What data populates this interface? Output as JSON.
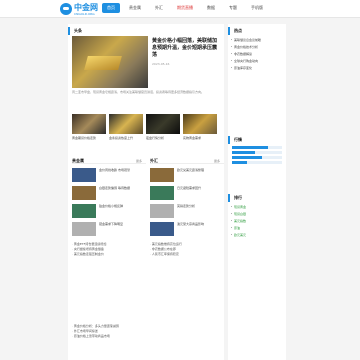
{
  "header": {
    "logo_text": "中金网",
    "logo_sub": "CNGOLD.ORG",
    "nav": [
      {
        "label": "首页",
        "active": true,
        "red": false
      },
      {
        "label": "贵金属",
        "active": false,
        "red": false
      },
      {
        "label": "外汇",
        "active": false,
        "red": false
      },
      {
        "label": "期货直播",
        "active": false,
        "red": true
      },
      {
        "label": "数据",
        "active": false,
        "red": false
      },
      {
        "label": "专题",
        "active": false,
        "red": false
      },
      {
        "label": "手机版",
        "active": false,
        "red": false
      }
    ]
  },
  "main": {
    "section_title": "头条",
    "hero_title": "黄金价格小幅回落，美联储加息预期升温，金价短期承压震荡",
    "hero_meta": "2023-05-16",
    "hero_summary": "周二亚市早盘，现货黄金窄幅震荡，市场关注美联储官员讲话，投资者等待更多经济数据指引方向。",
    "gallery": [
      {
        "caption": "黄金期货价格走势"
      },
      {
        "caption": "金条投资热度上升"
      },
      {
        "caption": "夜盘行情分析"
      },
      {
        "caption": "实物黄金需求"
      }
    ],
    "cols": [
      {
        "title": "贵金属",
        "more": "更多",
        "rows": [
          "金价周线收跌 市场观望",
          "白银走势偏弱 等待数据",
          "铂金价格小幅反弹",
          "钯金需求下降明显"
        ],
        "lines": [
          "· 黄金ETF持仓量连续增加",
          "· 央行继续增持黄金储备",
          "· 美元指数走强压制金价"
        ]
      },
      {
        "title": "外汇",
        "more": "更多",
        "rows": [
          "欧元兑美元震荡整理",
          "日元避险需求回升",
          "英镑走势分析",
          "澳元受大宗商品影响"
        ],
        "lines": [
          "· 美元指数维持高位运行",
          "· 非农数据公布在即",
          "· 人民币汇率保持稳定"
        ]
      }
    ],
    "bottom_lines": [
      "· 黄金价格分析：多头力量逐渐减弱",
      "· 外汇市场早间综述",
      "· 原油价格上涨带动商品市场"
    ]
  },
  "side": {
    "title1": "热点",
    "items1": [
      "美联储议息会议前瞻",
      "黄金价格技术分析",
      "非农数据解读",
      "全球央行购金动向",
      "原油库存变化"
    ],
    "title2": "行情",
    "bars": [
      0.72,
      0.45,
      0.6,
      0.3
    ],
    "title3": "排行",
    "items3": [
      "现货黄金",
      "现货白银",
      "美元指数",
      "原油",
      "欧元美元"
    ]
  }
}
